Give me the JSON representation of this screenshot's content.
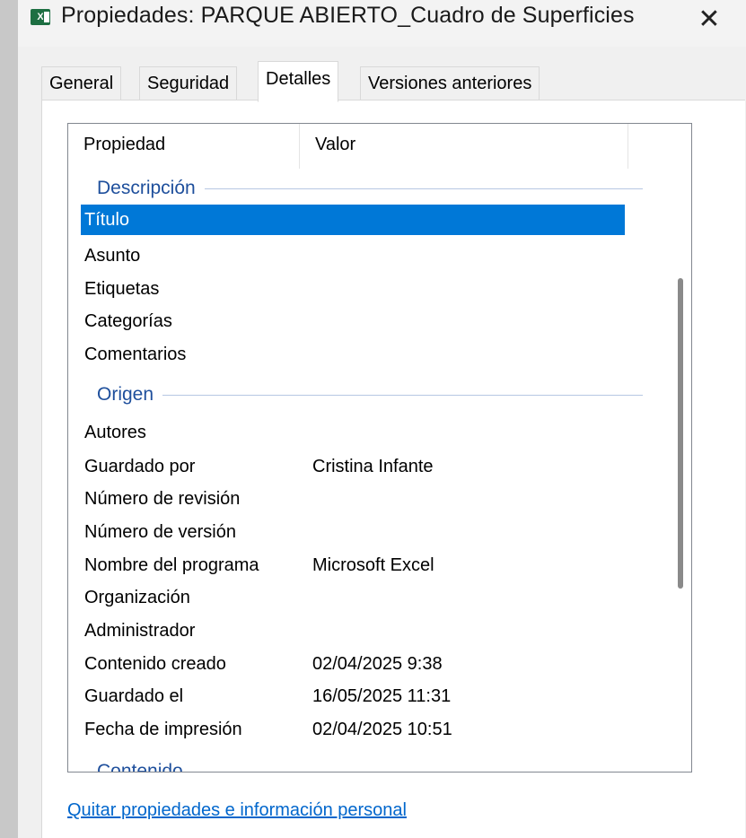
{
  "window": {
    "title": "Propiedades: PARQUE ABIERTO_Cuadro de Superficies",
    "app_icon_label": "X",
    "close_symbol": "✕"
  },
  "tabs": [
    {
      "label": "General",
      "active": false
    },
    {
      "label": "Seguridad",
      "active": false
    },
    {
      "label": "Detalles",
      "active": true
    },
    {
      "label": "Versiones anteriores",
      "active": false
    }
  ],
  "list": {
    "columns": [
      "Propiedad",
      "Valor"
    ],
    "groups": [
      {
        "label": "Descripción",
        "rows": [
          {
            "property": "Título",
            "value": "",
            "selected": true
          },
          {
            "property": "Asunto",
            "value": ""
          },
          {
            "property": "Etiquetas",
            "value": ""
          },
          {
            "property": "Categorías",
            "value": ""
          },
          {
            "property": "Comentarios",
            "value": ""
          }
        ]
      },
      {
        "label": "Origen",
        "rows": [
          {
            "property": "Autores",
            "value": ""
          },
          {
            "property": "Guardado por",
            "value": "Cristina Infante"
          },
          {
            "property": "Número de revisión",
            "value": ""
          },
          {
            "property": "Número de versión",
            "value": ""
          },
          {
            "property": "Nombre del programa",
            "value": "Microsoft Excel"
          },
          {
            "property": "Organización",
            "value": ""
          },
          {
            "property": "Administrador",
            "value": ""
          },
          {
            "property": "Contenido creado",
            "value": "02/04/2025 9:38"
          },
          {
            "property": "Guardado el",
            "value": "16/05/2025 11:31"
          },
          {
            "property": "Fecha de impresión",
            "value": "02/04/2025 10:51"
          }
        ]
      },
      {
        "label": "Contenido",
        "rows": []
      }
    ]
  },
  "link": {
    "label": "Quitar propiedades e información personal"
  },
  "colors": {
    "selection": "#0078d7",
    "group_label": "#1e4f9c",
    "link": "#0066cc"
  }
}
